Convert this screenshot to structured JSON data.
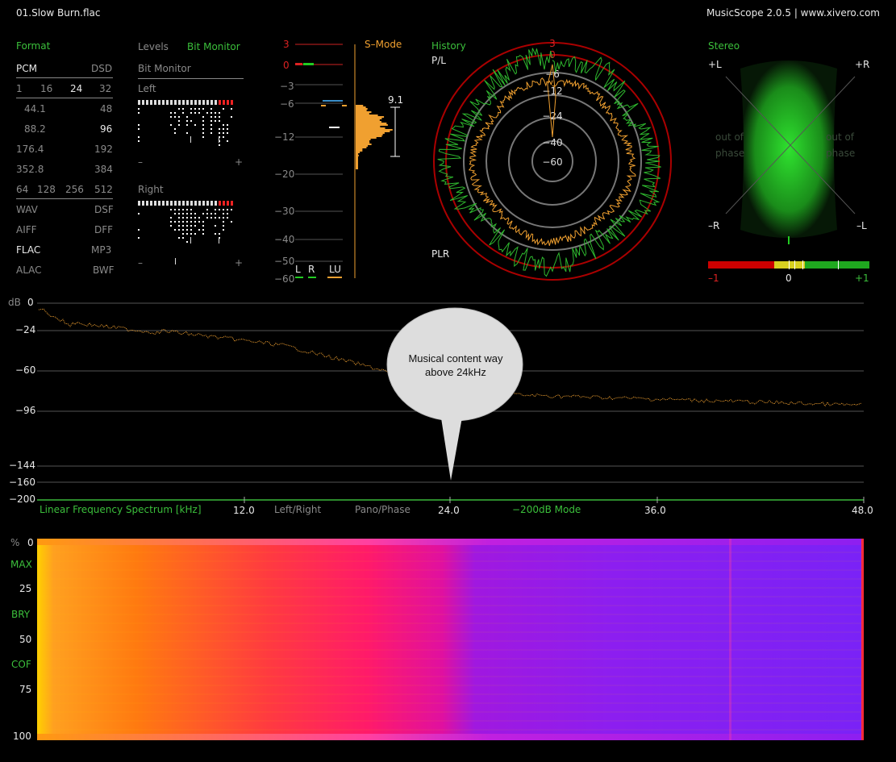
{
  "titlebar": {
    "file": "01.Slow Burn.flac",
    "app": "MusicScope 2.0.5 | www.xivero.com"
  },
  "format": {
    "title": "Format",
    "pcm": "PCM",
    "dsd": "DSD",
    "bits": [
      "1",
      "16",
      "24",
      "32"
    ],
    "rates": [
      [
        "44.1",
        "48"
      ],
      [
        "88.2",
        "96"
      ],
      [
        "176.4",
        "192"
      ],
      [
        "352.8",
        "384"
      ]
    ],
    "dsd_rates": [
      "64",
      "128",
      "256",
      "512"
    ],
    "codecs": [
      [
        "WAV",
        "DSF"
      ],
      [
        "AIFF",
        "DFF"
      ],
      [
        "FLAC",
        "MP3"
      ],
      [
        "ALAC",
        "BWF"
      ]
    ]
  },
  "levels": {
    "tab_levels": "Levels",
    "tab_bitmonitor": "Bit Monitor",
    "heading": "Bit Monitor",
    "left": "Left",
    "right": "Right",
    "minus": "–",
    "plus": "+"
  },
  "meter": {
    "scale": [
      "3",
      "0",
      "−3",
      "−6",
      "−12",
      "−20",
      "−30",
      "−40",
      "−50",
      "−60"
    ],
    "mode": "S–Mode",
    "value": "9.1",
    "labels": [
      "L",
      "R",
      "LU"
    ]
  },
  "history": {
    "title": "History",
    "pl": "P/L",
    "plr": "PLR",
    "rings": [
      "0",
      "−6",
      "−12",
      "−24",
      "−40",
      "−60"
    ],
    "top3": "3"
  },
  "stereo": {
    "title": "Stereo",
    "pl": "+L",
    "pr": "+R",
    "ml": "–R",
    "mr": "–L",
    "out_left": "out of",
    "out_right": "out of",
    "phase_left": "phase",
    "phase_right": "phase",
    "corr": [
      "–1",
      "0",
      "+1"
    ]
  },
  "spectrum": {
    "db_label": "dB",
    "y_ticks": [
      "0",
      "−24",
      "−60",
      "−96",
      "−144",
      "−160",
      "−200"
    ],
    "mode": "Linear Frequency Spectrum [kHz]",
    "x_ticks": [
      "12.0",
      "24.0",
      "36.0",
      "48.0"
    ],
    "btn_lr": "Left/Right",
    "btn_pano": "Pano/Phase",
    "btn_200": "−200dB Mode",
    "callout": "Musical content way above 24kHz"
  },
  "spectrogram": {
    "y_labels": [
      "%",
      "0",
      "MAX",
      "25",
      "BRY",
      "50",
      "COF",
      "75",
      "100"
    ]
  },
  "colors": {
    "green": "#3bbf3b",
    "orange": "#f0a030",
    "red": "#dd2222"
  }
}
